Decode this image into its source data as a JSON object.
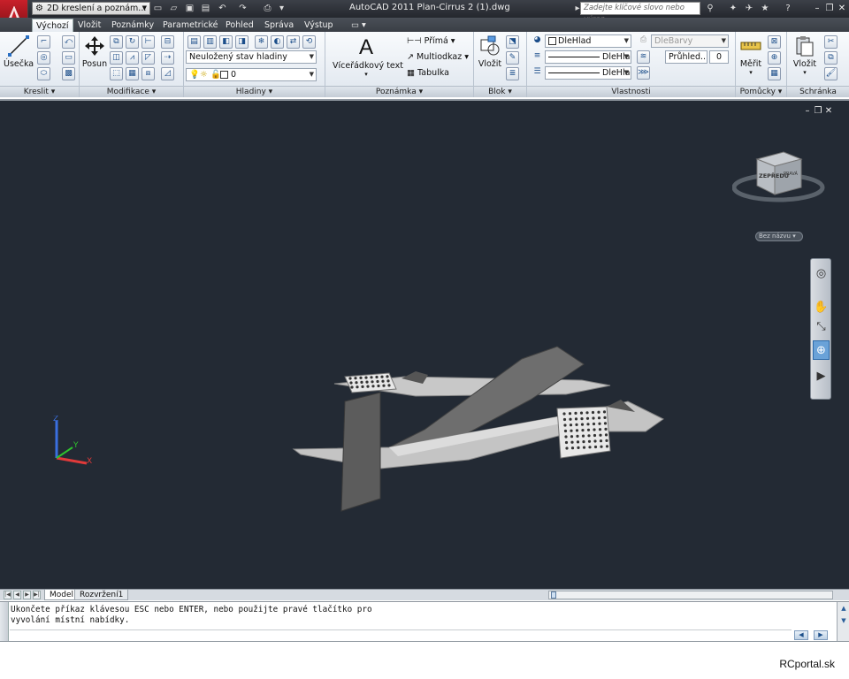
{
  "titlebar": {
    "workspace": "2D kreslení a poznám...",
    "title": "AutoCAD 2011    Plan-Cirrus 2 (1).dwg",
    "search_placeholder": "Zadejte klíčové slovo nebo výraz.",
    "colors": {
      "bar": "#2c3037",
      "logo": "#b3171f"
    }
  },
  "tabs": [
    {
      "label": "Výchozí"
    },
    {
      "label": "Vložit"
    },
    {
      "label": "Poznámky"
    },
    {
      "label": "Parametrické"
    },
    {
      "label": "Pohled"
    },
    {
      "label": "Správa"
    },
    {
      "label": "Výstup"
    }
  ],
  "ribbon": {
    "draw": {
      "line_label": "Úsečka",
      "panel": "Kreslit"
    },
    "modify": {
      "move_label": "Posun",
      "panel": "Modifikace"
    },
    "layers": {
      "state": "Neuložený stav hladiny",
      "current_layer": "0",
      "panel": "Hladiny"
    },
    "annotation": {
      "mtext_label": "Víceřádkový text",
      "dimension": "Přímá",
      "multileader": "Multiodkaz",
      "table": "Tabulka",
      "panel": "Poznámka"
    },
    "block": {
      "insert_label": "Vložit",
      "panel": "Blok"
    },
    "properties": {
      "color": "DleHlad",
      "linetype": "DleHlad",
      "lineweight": "DleHlad",
      "plotstyle": "DleBarvy",
      "transparency_label": "Průhled...",
      "transparency_value": "0",
      "panel": "Vlastnosti"
    },
    "utilities": {
      "measure_label": "Měřit",
      "panel": "Pomůcky"
    },
    "clipboard": {
      "paste_label": "Vložit",
      "panel": "Schránka"
    }
  },
  "viewport": {
    "background": "#232a34",
    "viewcube_face": "ZEPŘEDU",
    "viewcube_side": "PRAVÁ",
    "wcs_menu": "Bez názvu"
  },
  "layout_tabs": [
    "Model",
    "Rozvržení1"
  ],
  "command_line": {
    "line1": "Ukončete příkaz klávesou ESC nebo ENTER, nebo použijte pravé tlačítko pro",
    "line2": "vyvolání místní nabídky."
  },
  "watermark": "RCportal.sk"
}
